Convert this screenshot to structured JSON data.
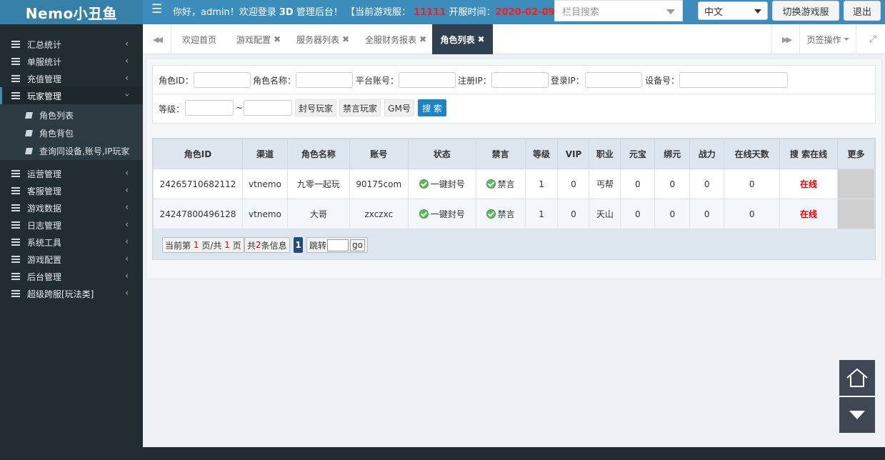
{
  "header": {
    "logo": "Nemo小丑鱼",
    "welcome_prefix": "你好，admin！欢迎登录",
    "welcome_bold": "3D",
    "welcome_suffix": "管理后台！ 【当前游戏服：",
    "server_id": "11111",
    "open_time_label": "开服时间：",
    "open_time": "2020-02-09",
    "search_placeholder": "栏目搜索",
    "language": "中文",
    "switch_server": "切换游戏服",
    "logout": "退出"
  },
  "sidebar": {
    "items": [
      {
        "label": "汇总统计"
      },
      {
        "label": "单服统计"
      },
      {
        "label": "充值管理"
      },
      {
        "label": "玩家管理"
      },
      {
        "label": "运营管理"
      },
      {
        "label": "客服管理"
      },
      {
        "label": "游戏数据"
      },
      {
        "label": "日志管理"
      },
      {
        "label": "系统工具"
      },
      {
        "label": "游戏配置"
      },
      {
        "label": "后台管理"
      },
      {
        "label": "超级跨服[玩法类]"
      }
    ],
    "subitems": [
      {
        "label": "角色列表"
      },
      {
        "label": "角色背包"
      },
      {
        "label": "查询同设备,账号,IP玩家"
      }
    ]
  },
  "tabs": {
    "items": [
      {
        "label": "欢迎首页"
      },
      {
        "label": "游戏配置"
      },
      {
        "label": "服务器列表"
      },
      {
        "label": "全服财务报表"
      },
      {
        "label": "角色列表"
      }
    ],
    "page_ops": "页签操作"
  },
  "search": {
    "role_id": "角色ID：",
    "role_name": "角色名称：",
    "platform_account": "平台账号：",
    "register_ip": "注册IP：",
    "login_ip": "登录IP：",
    "device_id": "设备号：",
    "level": "等级：",
    "tilde": "~",
    "ban_player": "封号玩家",
    "mute_player": "禁言玩家",
    "gm": "GM号",
    "search_btn": "搜 索"
  },
  "table": {
    "headers": [
      "角色ID",
      "渠道",
      "角色名称",
      "账号",
      "状态",
      "禁言",
      "等级",
      "VIP",
      "职业",
      "元宝",
      "绑元",
      "战力",
      "在线天数",
      "搜 索在线",
      "更多"
    ],
    "rows": [
      {
        "id": "24265710682112",
        "channel": "vtnemo",
        "name": "九零一起玩",
        "account": "90175com",
        "status": "一键封号",
        "mute": "禁言",
        "level": "1",
        "vip": "0",
        "job": "丐帮",
        "yuanbao": "0",
        "bind": "0",
        "power": "0",
        "days": "0",
        "online": "在线"
      },
      {
        "id": "24247800496128",
        "channel": "vtnemo",
        "name": "大哥",
        "account": "zxczxc",
        "status": "一键封号",
        "mute": "禁言",
        "level": "1",
        "vip": "0",
        "job": "天山",
        "yuanbao": "0",
        "bind": "0",
        "power": "0",
        "days": "0",
        "online": "在线"
      }
    ]
  },
  "pager": {
    "current_prefix": "当前第",
    "current": "1",
    "page_sep": "页/共",
    "total_pages": "1",
    "page_suffix": "页",
    "total_prefix": "共",
    "total": "2",
    "total_suffix": "条信息",
    "page_number": "1",
    "jump": "跳转",
    "go": "go"
  },
  "colors": {
    "header_bg": "#3c8dbc",
    "sidebar_bg": "#222d32",
    "active_tab": "#2f4050",
    "search_btn": "#1c84c6",
    "online": "#e60000"
  }
}
